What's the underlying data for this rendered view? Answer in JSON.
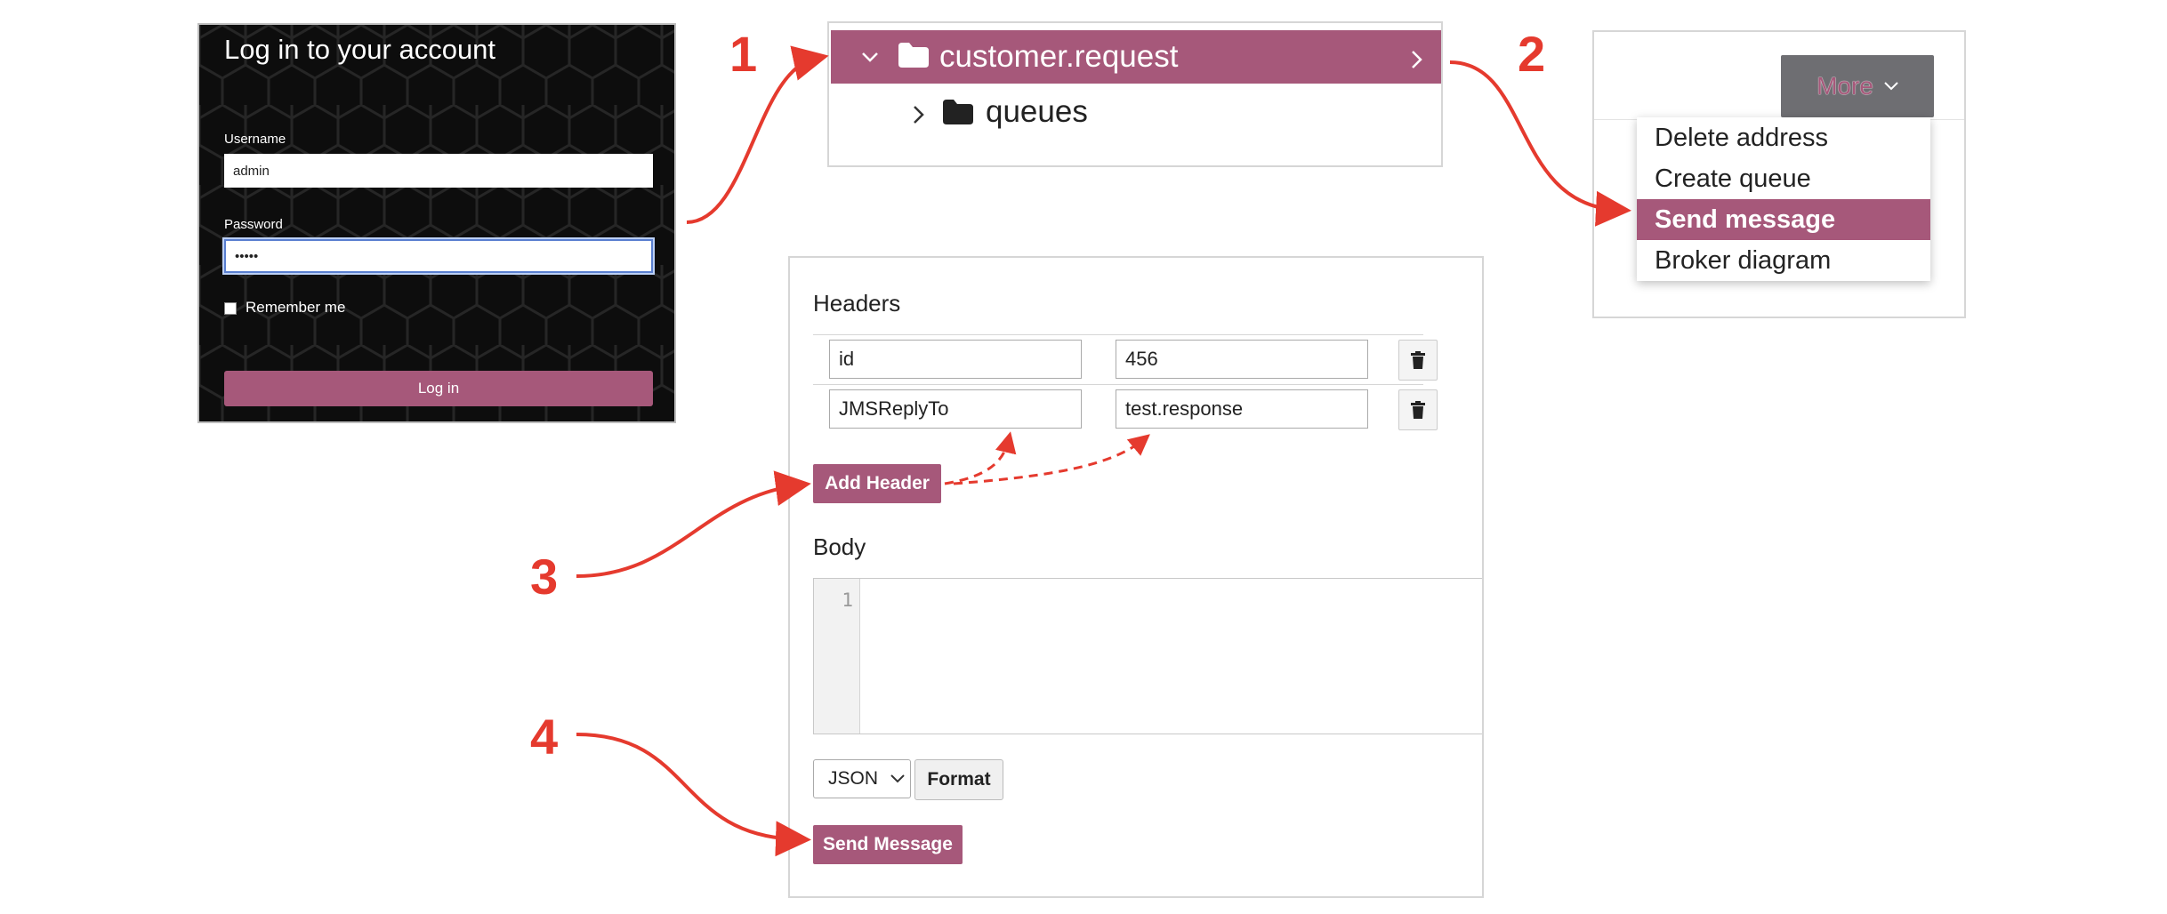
{
  "login": {
    "title": "Log in to your account",
    "username_label": "Username",
    "username_value": "admin",
    "password_label": "Password",
    "password_value": "•••••",
    "remember_label": "Remember me",
    "login_button": "Log in"
  },
  "tree": {
    "selected_item": "customer.request",
    "child_item": "queues"
  },
  "more_menu": {
    "button_label": "More",
    "items": [
      "Delete address",
      "Create queue",
      "Send message",
      "Broker diagram"
    ],
    "active_item": "Send message"
  },
  "send_form": {
    "headers_title": "Headers",
    "headers": [
      {
        "key": "id",
        "value": "456"
      },
      {
        "key": "JMSReplyTo",
        "value": "test.response"
      }
    ],
    "add_header_button": "Add Header",
    "body_title": "Body",
    "line_number": "1",
    "format_select": "JSON",
    "format_button": "Format",
    "send_button": "Send Message"
  },
  "steps": [
    "1",
    "2",
    "3",
    "4"
  ],
  "colors": {
    "accent": "#a6587a",
    "annotation": "#e53a2e",
    "login_bg": "#0d0d0d"
  }
}
